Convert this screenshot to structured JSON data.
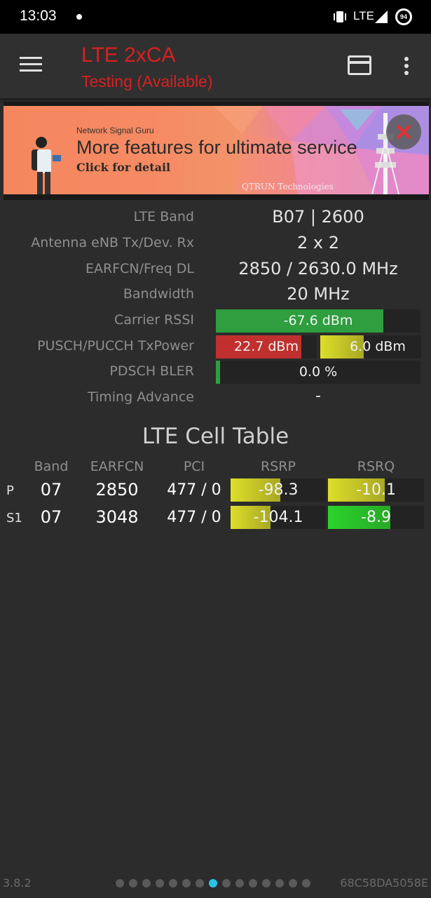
{
  "status_bar": {
    "time": "13:03",
    "network": "LTE",
    "battery": "94",
    "icons": [
      "vibrate-icon",
      "signal-icon",
      "battery-icon"
    ]
  },
  "app_bar": {
    "title": "LTE 2xCA",
    "subtitle": "Testing (Available)",
    "title_color": "#d82020",
    "actions": [
      "menu-icon",
      "card-icon",
      "overflow-icon"
    ]
  },
  "ad": {
    "brand": "Network Signal Guru",
    "headline": "More features for ultimate service",
    "cta": "Click for detail",
    "company": "QTRUN Technologies"
  },
  "info": {
    "band_label": "LTE Band",
    "band_value": "B07 | 2600",
    "antenna_label": "Antenna eNB Tx/Dev. Rx",
    "antenna_value": "2 x 2",
    "earfcn_label": "EARFCN/Freq DL",
    "earfcn_value": "2850 / 2630.0 MHz",
    "bandwidth_label": "Bandwidth",
    "bandwidth_value": "20 MHz",
    "rssi_label": "Carrier RSSI",
    "rssi_value": "-67.6 dBm",
    "rssi_level": 0.82,
    "txpower_label": "PUSCH/PUCCH TxPower",
    "pusch_value": "22.7 dBm",
    "pusch_level": 0.85,
    "pucch_value": "6.0 dBm",
    "pucch_level": 0.43,
    "bler_label": "PDSCH BLER",
    "bler_value": "0.0 %",
    "bler_level": 0.02,
    "ta_label": "Timing Advance",
    "ta_value": "-"
  },
  "cell_table": {
    "title": "LTE Cell Table",
    "headers": [
      "Band",
      "EARFCN",
      "PCI",
      "RSRP",
      "RSRQ"
    ],
    "rows": [
      {
        "label": "P",
        "band": "07",
        "earfcn": "2850",
        "pci": "477 / 0",
        "rsrp": "-98.3",
        "rsrp_level": 0.52,
        "rsrq": "-10.1",
        "rsrq_level": 0.59
      },
      {
        "label": "S1",
        "band": "07",
        "earfcn": "3048",
        "pci": "477 / 0",
        "rsrp": "-104.1",
        "rsrp_level": 0.42,
        "rsrq": "-8.9",
        "rsrq_level": 0.65
      }
    ]
  },
  "colors": {
    "green": "#2e9e3e",
    "red": "#c0302e",
    "yellow": "#cccc2a",
    "bright_green": "#2bd42b",
    "accent_dot": "#27c4e8"
  },
  "footer": {
    "version": "3.8.2",
    "device_id": "68C58DA5058E",
    "page_count": 15,
    "active_page": 8
  }
}
